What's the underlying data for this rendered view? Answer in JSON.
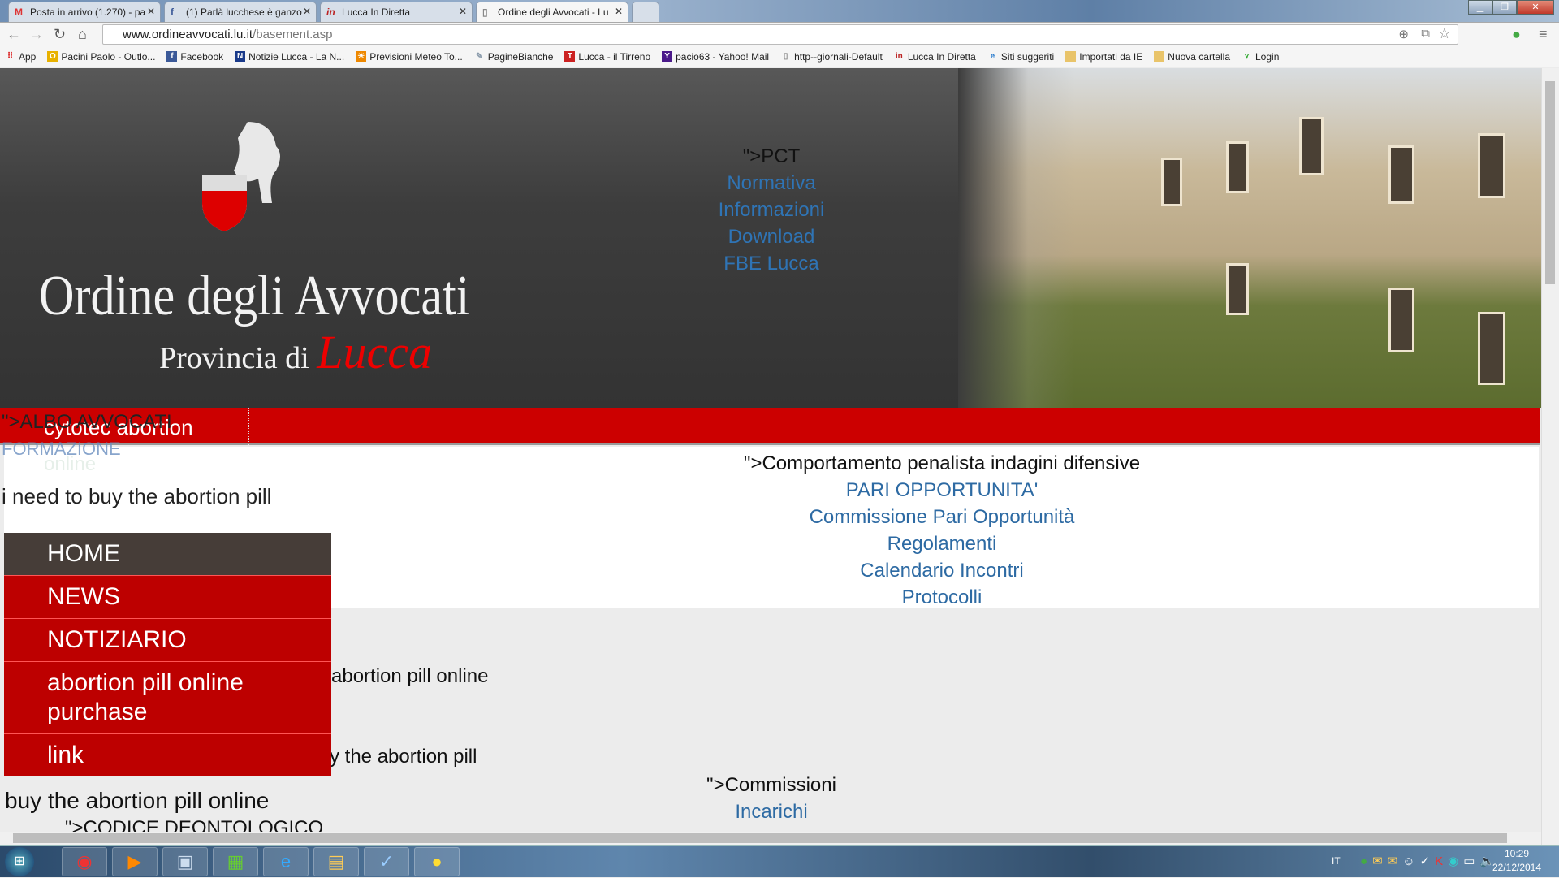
{
  "browser": {
    "tabs": [
      {
        "label": "Posta in arrivo (1.270) - pa",
        "icon": "gmail-icon"
      },
      {
        "label": "(1) Parlà lucchese è ganzo",
        "icon": "facebook-icon"
      },
      {
        "label": "Lucca In Diretta",
        "icon": "luccaindiretta-icon"
      },
      {
        "label": "Ordine degli Avvocati - Lu",
        "icon": "page-icon",
        "active": true
      }
    ],
    "url_host": "www.ordineavvocati.lu.it",
    "url_path": "/basement.asp",
    "bookmarks": [
      "App",
      "Pacini Paolo - Outlo...",
      "Facebook",
      "Notizie Lucca - La N...",
      "Previsioni Meteo To...",
      "PagineBianche",
      "Lucca - il Tirreno",
      "pacio63 - Yahoo! Mail",
      "http--giornali-Default",
      "Lucca In Diretta",
      "Siti suggeriti",
      "Importati da IE",
      "Nuova cartella",
      "Login"
    ]
  },
  "site": {
    "logo": {
      "title": "Ordine degli Avvocati",
      "subtitle": "Provincia di",
      "city": "Lucca"
    },
    "pct_menu": {
      "heading": "\">PCT",
      "links": [
        "Normativa",
        "Informazioni",
        "Download",
        "FBE Lucca"
      ]
    },
    "redbar_label": "cytotec abortion",
    "overlap": {
      "albo": "\">ALBO AVVOCATI",
      "formazione": "FORMAZIONE",
      "online": "online"
    },
    "need_text": "i need to buy the abortion pill",
    "menu": [
      "HOME",
      "NEWS",
      "NOTIZIARIO",
      "abortion pill online purchase",
      "link"
    ],
    "center": {
      "heading": "\">Comportamento penalista indagini difensive",
      "links": [
        "PARI OPPORTUNITA'",
        "Commissione Pari Opportunità",
        "Regolamenti",
        "Calendario Incontri",
        "Protocolli"
      ]
    },
    "text_abortion_online": "abortion pill online",
    "text_buy_pill": "y the abortion pill",
    "text_buy_online": "buy the abortion pill online",
    "commissioni": {
      "heading": "\">Commissioni",
      "link": "Incarichi"
    },
    "codice": "\">CODICE DEONTOLOGICO"
  },
  "taskbar": {
    "lang": "IT",
    "time": "10:29",
    "date": "22/12/2014"
  },
  "colors": {
    "brand_red": "#c00000",
    "link_blue": "#2d6aa3",
    "menu_home": "#463d38"
  }
}
